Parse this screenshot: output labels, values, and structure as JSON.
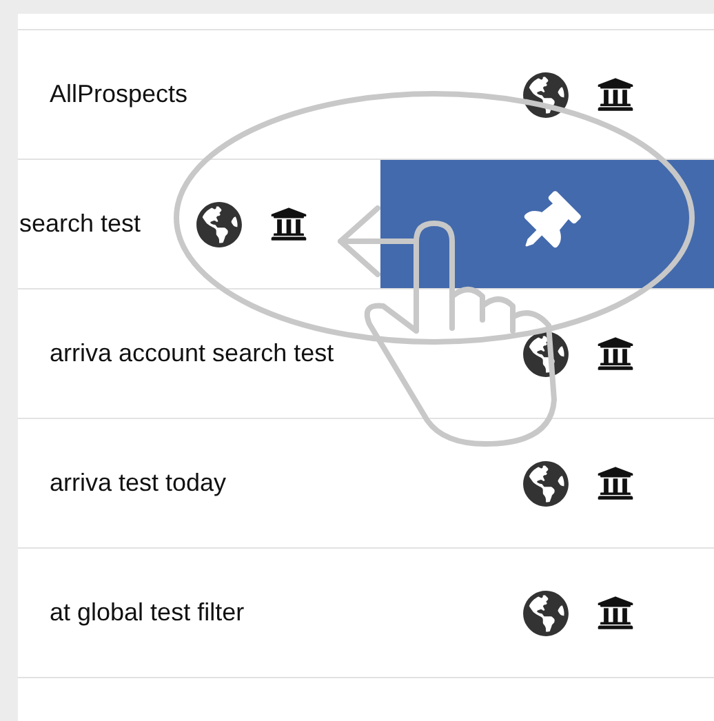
{
  "rows": [
    {
      "label": "AllProspects",
      "kind": "normal"
    },
    {
      "label": "search test",
      "kind": "swiped"
    },
    {
      "label": "arriva account search test",
      "kind": "normal"
    },
    {
      "label": "arriva test today",
      "kind": "normal"
    },
    {
      "label": "at global test filter",
      "kind": "normal"
    }
  ]
}
